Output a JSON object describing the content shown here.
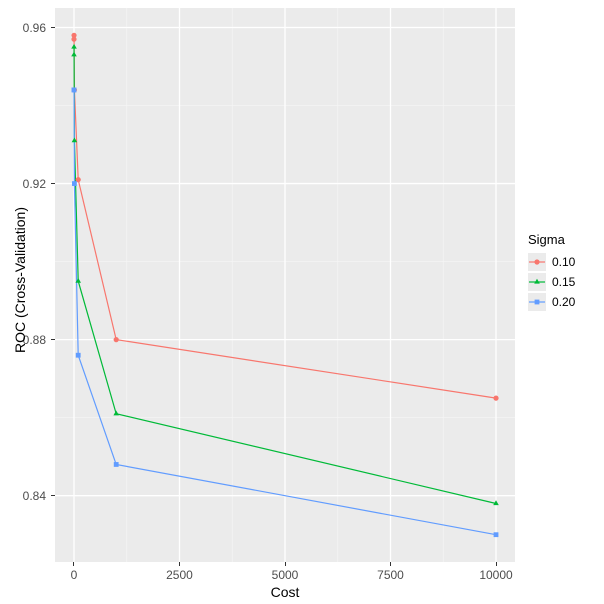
{
  "chart_data": {
    "type": "line",
    "xlabel": "Cost",
    "ylabel": "ROC (Cross-Validation)",
    "legend_title": "Sigma",
    "xlim": [
      -450,
      10450
    ],
    "ylim": [
      0.823,
      0.965
    ],
    "x_ticks": [
      0,
      2500,
      5000,
      7500,
      10000
    ],
    "y_ticks": [
      0.84,
      0.88,
      0.92,
      0.96
    ],
    "x_minor": [
      1250,
      3750,
      6250,
      8750
    ],
    "y_minor": [
      0.86,
      0.9,
      0.94
    ],
    "x": [
      0.1,
      1,
      10,
      100,
      1000,
      10000
    ],
    "series": [
      {
        "name": "0.10",
        "color": "#F8766D",
        "shape": "circle",
        "values": [
          0.957,
          0.958,
          0.944,
          0.921,
          0.88,
          0.865,
          0.856
        ]
      },
      {
        "name": "0.15",
        "color": "#00BA38",
        "shape": "triangle",
        "values": [
          0.953,
          0.955,
          0.931,
          0.895,
          0.861,
          0.838,
          0.838
        ]
      },
      {
        "name": "0.20",
        "color": "#619CFF",
        "shape": "square",
        "values": [
          0.944,
          0.944,
          0.92,
          0.876,
          0.848,
          0.83,
          0.83
        ]
      }
    ],
    "x_for_series": [
      0.1,
      1,
      10,
      100,
      1000,
      10000
    ],
    "note_x_points": [
      0.1,
      1,
      10,
      100,
      1000,
      10000
    ]
  },
  "x_for_plot": [
    0.1,
    1,
    10,
    100,
    1000,
    10000
  ]
}
